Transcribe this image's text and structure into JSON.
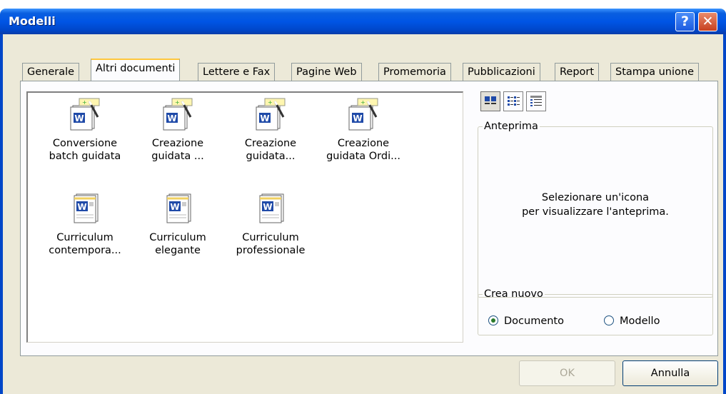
{
  "window": {
    "title": "Modelli",
    "help_glyph": "?",
    "close_glyph": "✕"
  },
  "tabs": [
    {
      "label": "Generale"
    },
    {
      "label": "Altri documenti"
    },
    {
      "label": "Lettere e Fax"
    },
    {
      "label": "Pagine Web"
    },
    {
      "label": "Promemoria"
    },
    {
      "label": "Pubblicazioni"
    },
    {
      "label": "Report"
    },
    {
      "label": "Stampa unione"
    }
  ],
  "active_tab": "Altri documenti",
  "templates": [
    {
      "line1": "Conversione",
      "line2": "batch guidata",
      "icon": "word-wizard-icon"
    },
    {
      "line1": "Creazione",
      "line2": "guidata ...",
      "icon": "word-wizard-icon"
    },
    {
      "line1": "Creazione",
      "line2": "guidata...",
      "icon": "word-wizard-icon"
    },
    {
      "line1": "Creazione",
      "line2": "guidata Ordi...",
      "icon": "word-wizard-icon"
    },
    {
      "line1": "Curriculum",
      "line2": "contempora...",
      "icon": "word-document-icon"
    },
    {
      "line1": "Curriculum",
      "line2": "elegante",
      "icon": "word-document-icon"
    },
    {
      "line1": "Curriculum",
      "line2": "professionale",
      "icon": "word-document-icon"
    }
  ],
  "view_buttons": [
    "large-icons-view-icon",
    "list-view-icon",
    "details-view-icon"
  ],
  "preview": {
    "legend": "Anteprima",
    "line1": "Selezionare un'icona",
    "line2": "per visualizzare l'anteprima."
  },
  "create_new": {
    "legend": "Crea nuovo",
    "option_document": "Documento",
    "option_template": "Modello",
    "selected": "Documento"
  },
  "buttons": {
    "ok": "OK",
    "cancel": "Annulla"
  },
  "colors": {
    "titlebar": "#0055e5",
    "dialog_bg": "#ece9d8",
    "word_blue": "#1f4aa8"
  }
}
